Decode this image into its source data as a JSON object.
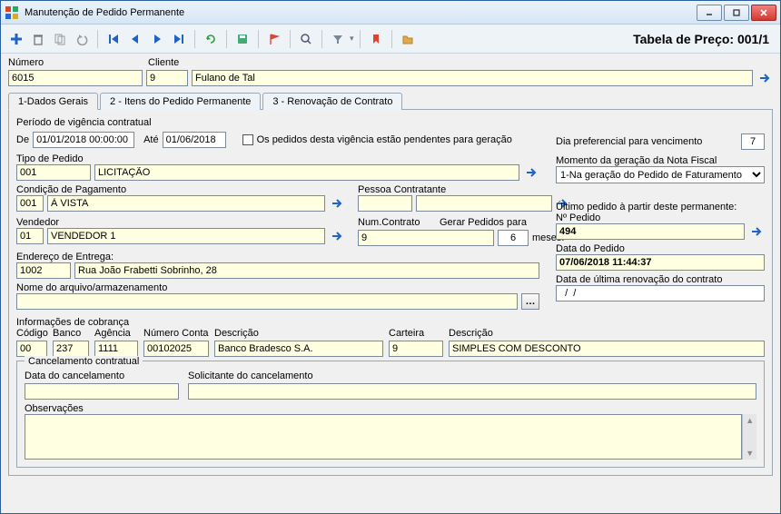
{
  "window": {
    "title": "Manutenção de Pedido Permanente"
  },
  "toolbar": {
    "price_label": "Tabela de Preço: 001/1"
  },
  "header": {
    "numero_label": "Número",
    "numero": "6015",
    "cliente_label": "Cliente",
    "cliente_code": "9",
    "cliente_name": "Fulano de Tal"
  },
  "tabs": {
    "t1": "1-Dados Gerais",
    "t2": "2 - Itens do Pedido Permanente",
    "t3": "3 - Renovação de Contrato"
  },
  "periodo": {
    "title": "Período de vigência contratual",
    "de_label": "De",
    "de": "01/01/2018 00:00:00",
    "ate_label": "Até",
    "ate": "01/06/2018",
    "pend_label": "Os pedidos desta vigência estão pendentes para geração"
  },
  "tipo_pedido": {
    "label": "Tipo de Pedido",
    "code": "001",
    "desc": "LICITAÇÃO"
  },
  "cond_pag": {
    "label": "Condição de Pagamento",
    "code": "001",
    "desc": "À VISTA"
  },
  "pessoa": {
    "label": "Pessoa Contratante",
    "code": "",
    "desc": ""
  },
  "vendedor": {
    "label": "Vendedor",
    "code": "01",
    "desc": "VENDEDOR 1"
  },
  "contrato": {
    "num_label": "Num.Contrato",
    "num": "9",
    "gerar_label": "Gerar Pedidos para",
    "gerar": "6",
    "meses": "meses."
  },
  "endereco": {
    "label": "Endereço de Entrega:",
    "code": "1002",
    "desc": "Rua João Frabetti Sobrinho, 28"
  },
  "arquivo": {
    "label": "Nome do arquivo/armazenamento",
    "value": ""
  },
  "cobranca": {
    "title": "Informações de cobrança",
    "codigo_l": "Código",
    "codigo": "00",
    "banco_l": "Banco",
    "banco": "237",
    "agencia_l": "Agência",
    "agencia": "1111",
    "conta_l": "Número Conta",
    "conta": "00102025",
    "descr_l": "Descrição",
    "descr": "Banco Bradesco S.A.",
    "carteira_l": "Carteira",
    "carteira": "9",
    "descr2_l": "Descrição",
    "descr2": "SIMPLES COM DESCONTO"
  },
  "cancel": {
    "title": "Cancelamento contratual",
    "data_l": "Data do cancelamento",
    "data": "",
    "solic_l": "Solicitante do cancelamento",
    "solic": "",
    "obs_l": "Observações",
    "obs": ""
  },
  "right": {
    "dia_l": "Dia preferencial para vencimento",
    "dia": "7",
    "momento_l": "Momento da geração da Nota Fiscal",
    "momento": "1-Na geração do Pedido de Faturamento",
    "ultimo_l": "Último pedido à partir deste permanente:",
    "npedido_l": "Nº Pedido",
    "npedido": "494",
    "datap_l": "Data do Pedido",
    "datap": "07/06/2018 11:44:37",
    "renov_l": "Data de última renovação do contrato",
    "renov": "  /  /"
  }
}
